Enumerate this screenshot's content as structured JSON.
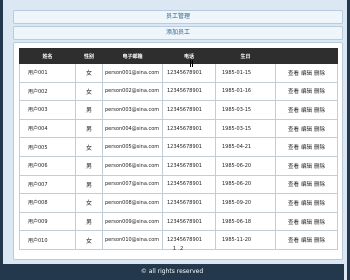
{
  "nav": {
    "title": "员工管理",
    "add_label": "添加员工"
  },
  "table": {
    "headers": [
      "姓名",
      "性别",
      "电子邮箱",
      "电话",
      "生日",
      ""
    ],
    "rows": [
      {
        "name": "用户001",
        "gender": "女",
        "email": "person001@sina.com",
        "phone": "12345678901",
        "birthday": "1985-01-15"
      },
      {
        "name": "用户002",
        "gender": "女",
        "email": "person002@sina.com",
        "phone": "12345678901",
        "birthday": "1985-01-16"
      },
      {
        "name": "用户003",
        "gender": "男",
        "email": "person003@sina.com",
        "phone": "12345678901",
        "birthday": "1985-03-15"
      },
      {
        "name": "用户004",
        "gender": "男",
        "email": "person004@sina.com",
        "phone": "12345678901",
        "birthday": "1985-03-15"
      },
      {
        "name": "用户005",
        "gender": "女",
        "email": "person005@sina.com",
        "phone": "12345678901",
        "birthday": "1985-04-21"
      },
      {
        "name": "用户006",
        "gender": "男",
        "email": "person006@sina.com",
        "phone": "12345678901",
        "birthday": "1985-06-20"
      },
      {
        "name": "用户007",
        "gender": "男",
        "email": "person007@sina.com",
        "phone": "12345678901",
        "birthday": "1985-06-20"
      },
      {
        "name": "用户008",
        "gender": "女",
        "email": "person008@sina.com",
        "phone": "12345678901",
        "birthday": "1985-09-20"
      },
      {
        "name": "用户009",
        "gender": "男",
        "email": "person009@sina.com",
        "phone": "12345678901",
        "birthday": "1985-06-18"
      },
      {
        "name": "用户010",
        "gender": "女",
        "email": "person010@sina.com",
        "phone": "12345678901",
        "birthday": "1985-11-20"
      }
    ],
    "actions": {
      "view": "查看",
      "edit": "编辑",
      "delete": "删除"
    }
  },
  "pager": {
    "pages": [
      "1",
      "2"
    ]
  },
  "footer": {
    "text": "© all rights reserved"
  },
  "colors": {
    "frame": "#23374d",
    "background": "#dbe7f2",
    "nav_bar": "#eef6fc",
    "header": "#2e2e2e"
  }
}
